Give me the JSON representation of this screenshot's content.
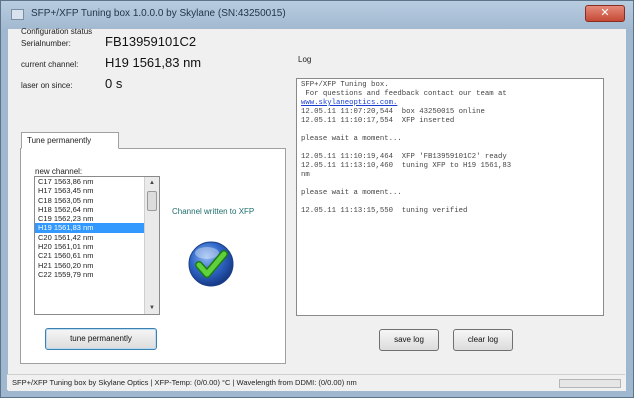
{
  "window": {
    "title": "SFP+/XFP Tuning box 1.0.0.0 by Skylane (SN:43250015)",
    "close_label": "✕"
  },
  "config": {
    "status_label": "Configuration status",
    "serial_label": "Serialnumber:",
    "serial_value": "FB13959101C2",
    "channel_label": "current channel:",
    "channel_value": "H19 1561,83 nm",
    "laser_label": "laser on since:",
    "laser_value": "0 s"
  },
  "tune_tab": {
    "tab_label": "Tune permanently",
    "new_channel_label": "new channel:",
    "channels": [
      "C17 1563,86 nm",
      "H17 1563,45 nm",
      "C18 1563,05 nm",
      "H18 1562,64 nm",
      "C19 1562,23 nm",
      "H19 1561,83 nm",
      "C20 1561,42 nm",
      "H20 1561,01 nm",
      "C21 1560,61 nm",
      "H21 1560,20 nm",
      "C22 1559,79 nm"
    ],
    "selected_channel": "H19 1561,83 nm",
    "status_message": "Channel written to XFP",
    "tune_button": "tune permanently"
  },
  "log": {
    "label": "Log",
    "lines": [
      "SFP+/XFP Tuning box.",
      " For questions and feedback contact our team at",
      "www.skylaneoptics.com.",
      "12.05.11 11:07:20,544  box 43250015 online",
      "12.05.11 11:10:17,554  XFP inserted",
      "",
      "please wait a moment...",
      "",
      "12.05.11 11:10:19,464  XFP 'FB13959101C2' ready",
      "12.05.11 11:13:10,460  tuning XFP to H19 1561,83",
      "nm",
      "",
      "please wait a moment...",
      "",
      "12.05.11 11:13:15,550  tuning verified"
    ],
    "save_button": "save log",
    "clear_button": "clear log"
  },
  "statusbar": {
    "text": "SFP+/XFP Tuning box by Skylane Optics | XFP-Temp: (0/0.00) °C | Wavelength from DDMI: (0/0.00) nm"
  },
  "icons": {
    "app": "app-icon",
    "success": "checkmark-globe-icon"
  },
  "colors": {
    "selection": "#3399ff",
    "window_frame": "#9fb7cf",
    "status_message": "#1f6e6e",
    "link": "#1a3fcf"
  }
}
